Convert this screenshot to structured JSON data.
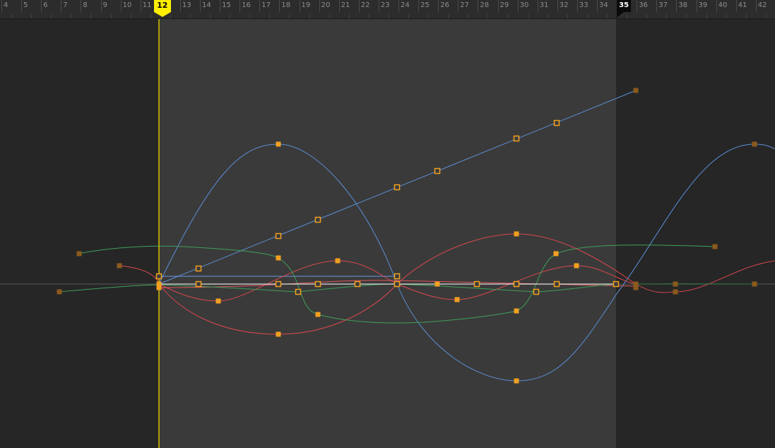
{
  "timeline": {
    "frames": [
      "4",
      "5",
      "6",
      "7",
      "8",
      "9",
      "10",
      "11",
      "12",
      "13",
      "14",
      "15",
      "16",
      "17",
      "18",
      "19",
      "20",
      "21",
      "22",
      "23",
      "24",
      "25",
      "26",
      "27",
      "28",
      "29",
      "30",
      "31",
      "32",
      "33",
      "34",
      "35",
      "36",
      "37",
      "38",
      "39",
      "40",
      "41",
      "42"
    ],
    "current_frame": "12",
    "range_end_frame": "35",
    "colors": {
      "playhead": "#ffee00",
      "end_marker_bg": "#0a0a0a",
      "active_range": "#3a3a3a",
      "inactive_range": "#262626",
      "curve_blue": "#5b8fd6",
      "curve_red": "#d9484f",
      "curve_green": "#3fa05a",
      "key_active": "#f0a020",
      "key_dim": "#8c5a1c"
    }
  }
}
